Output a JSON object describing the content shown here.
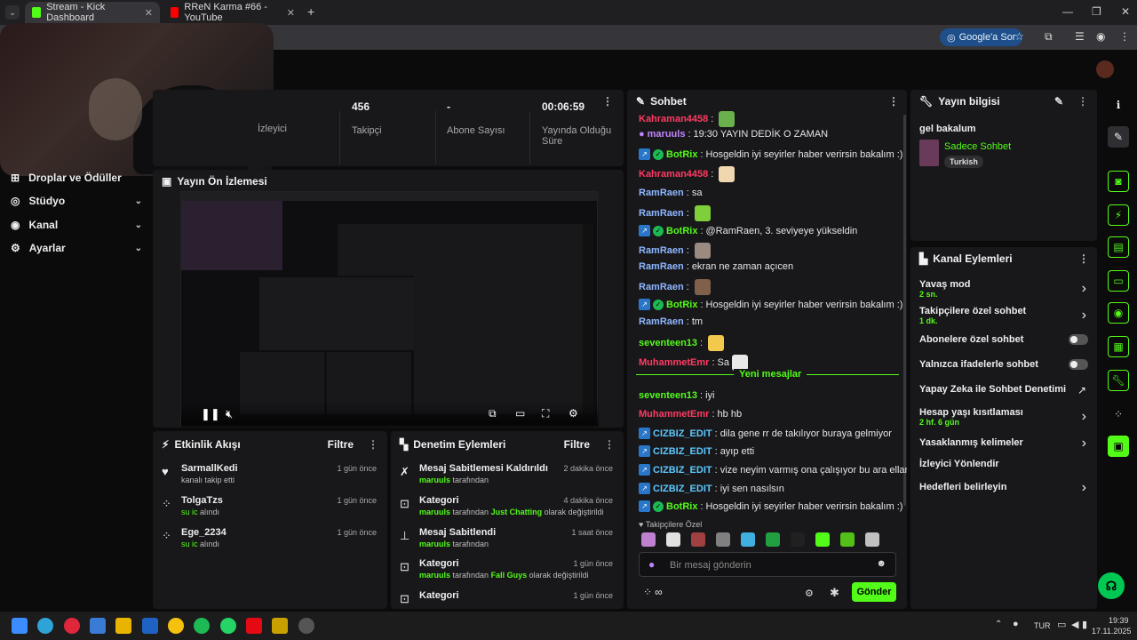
{
  "browser": {
    "tabs": [
      {
        "label": "Stream - Kick Dashboard",
        "active": true
      },
      {
        "label": "RReN Karma #66 - YouTube",
        "active": false
      }
    ],
    "new_tab": "+",
    "google_ask": "Google'a Sor"
  },
  "nav": {
    "items": [
      {
        "label": "Droplar ve Ödüller",
        "icon": "gift-icon"
      },
      {
        "label": "Stüdyo",
        "icon": "studio-icon"
      },
      {
        "label": "Kanal",
        "icon": "channel-icon"
      },
      {
        "label": "Ayarlar",
        "icon": "gear-icon"
      }
    ]
  },
  "stats": {
    "viewers_label": "İzleyici",
    "followers": {
      "value": "456",
      "label": "Takipçi"
    },
    "subscribers": {
      "value": "-",
      "label": "Abone Sayısı"
    },
    "uptime": {
      "value": "00:06:59",
      "label": "Yayında Olduğu Süre"
    }
  },
  "preview": {
    "title": "Yayın Ön İzlemesi"
  },
  "activity": {
    "title": "Etkinlik Akışı",
    "filter": "Filtre",
    "rows": [
      {
        "name": "SarmallKedi",
        "detail": "kanalı takip etti",
        "time": "1 gün önce",
        "detail_green": false
      },
      {
        "name": "TolgaTzs",
        "detail": "su ic",
        "detail2": "alındı",
        "time": "1 gün önce",
        "detail_green": true
      },
      {
        "name": "Ege_2234",
        "detail": "su ic",
        "detail2": "alındı",
        "time": "1 gün önce",
        "detail_green": true
      }
    ]
  },
  "moderation": {
    "title": "Denetim Eylemleri",
    "filter": "Filtre",
    "rows": [
      {
        "title": "Mesaj Sabitlemesi Kaldırıldı",
        "user": "maruuls",
        "text": "tarafından",
        "time": "2 dakika önce"
      },
      {
        "title": "Kategori",
        "user": "maruuls",
        "text": "tarafından",
        "cat": "Just Chatting",
        "text2": "olarak değiştirildi",
        "time": "4 dakika önce"
      },
      {
        "title": "Mesaj Sabitlendi",
        "user": "maruuls",
        "text": "tarafından",
        "time": "1 saat önce"
      },
      {
        "title": "Kategori",
        "user": "maruuls",
        "text": "tarafından",
        "cat": "Fall Guys",
        "text2": "olarak değiştirildi",
        "time": "1 gün önce"
      },
      {
        "title": "Kategori",
        "time": "1 gün önce"
      }
    ]
  },
  "chat": {
    "title": "Sohbet",
    "messages": [
      {
        "user": "Kahraman4458",
        "color": "red",
        "text": ""
      },
      {
        "user": "maruuls",
        "color": "purple",
        "text": "19:30 YAYIN DEDİK O ZAMAN"
      },
      {
        "user": "BotRix",
        "color": "green",
        "text": "Hosgeldin iyi seyirler haber verirsin bakalım :)"
      },
      {
        "user": "Kahraman4458",
        "color": "red",
        "text": ""
      },
      {
        "user": "RamRaen",
        "color": "blue",
        "text": "sa"
      },
      {
        "user": "RamRaen",
        "color": "blue",
        "text": ""
      },
      {
        "user": "BotRix",
        "color": "green",
        "text": "@RamRaen, 3. seviyeye yükseldin"
      },
      {
        "user": "RamRaen",
        "color": "blue",
        "text": ""
      },
      {
        "user": "RamRaen",
        "color": "blue",
        "text": "ekran ne zaman açıcen"
      },
      {
        "user": "RamRaen",
        "color": "blue",
        "text": ""
      },
      {
        "user": "BotRix",
        "color": "green",
        "text": "Hosgeldin iyi seyirler haber verirsin bakalım :)"
      },
      {
        "user": "RamRaen",
        "color": "blue",
        "text": "tm"
      },
      {
        "user": "seventeen13",
        "color": "green",
        "text": ""
      },
      {
        "user": "MuhammetEmr",
        "color": "red",
        "text": "Sa"
      },
      {
        "user": "seventeen13",
        "color": "green",
        "text": "iyi"
      },
      {
        "user": "MuhammetEmr",
        "color": "red",
        "text": "hb hb"
      },
      {
        "user": "CIZBIZ_EDIT",
        "color": "cyan",
        "text": "dila gene rr de takılıyor buraya gelmiyor"
      },
      {
        "user": "CIZBIZ_EDIT",
        "color": "cyan",
        "text": "ayıp etti"
      },
      {
        "user": "CIZBIZ_EDIT",
        "color": "cyan",
        "text": "vize neyim varmış ona çalışıyor bu ara ellam"
      },
      {
        "user": "CIZBIZ_EDIT",
        "color": "cyan",
        "text": "iyi sen nasılsın"
      },
      {
        "user": "BotRix",
        "color": "green",
        "text": "Hosgeldin iyi seyirler haber verirsin bakalım :)"
      }
    ],
    "new_messages": "Yeni mesajlar",
    "followers_only": "Takipçilere Özel",
    "input_placeholder": "Bir mesaj gönderin",
    "send": "Gönder",
    "infinity": "∞"
  },
  "stream_info": {
    "title": "Yayın bilgisi",
    "stream_title": "gel bakalum",
    "category": "Sadece Sohbet",
    "language": "Turkish"
  },
  "channel_actions": {
    "title": "Kanal Eylemleri",
    "items": [
      {
        "label": "Yavaş mod",
        "sub": "2 sn.",
        "control": "arrow"
      },
      {
        "label": "Takipçilere özel sohbet",
        "sub": "1 dk.",
        "control": "arrow"
      },
      {
        "label": "Abonelere özel sohbet",
        "sub": "",
        "control": "toggle"
      },
      {
        "label": "Yalnızca ifadelerle sohbet",
        "sub": "",
        "control": "toggle"
      },
      {
        "label": "Yapay Zeka ile Sohbet Denetimi",
        "sub": "",
        "control": "external"
      },
      {
        "label": "Hesap yaşı kısıtlaması",
        "sub": "2 hf. 6 gün",
        "control": "arrow"
      },
      {
        "label": "Yasaklanmış kelimeler",
        "sub": "",
        "control": "arrow"
      },
      {
        "label": "İzleyici Yönlendir",
        "sub": "",
        "control": "none"
      },
      {
        "label": "Hedefleri belirleyin",
        "sub": "",
        "control": "arrow"
      }
    ]
  },
  "taskbar": {
    "lang": "TUR",
    "time": "19:39",
    "date": "17.11.2025"
  },
  "colors": {
    "accent": "#53fc18",
    "panel": "#18181b",
    "bg": "#0b0b0c"
  }
}
